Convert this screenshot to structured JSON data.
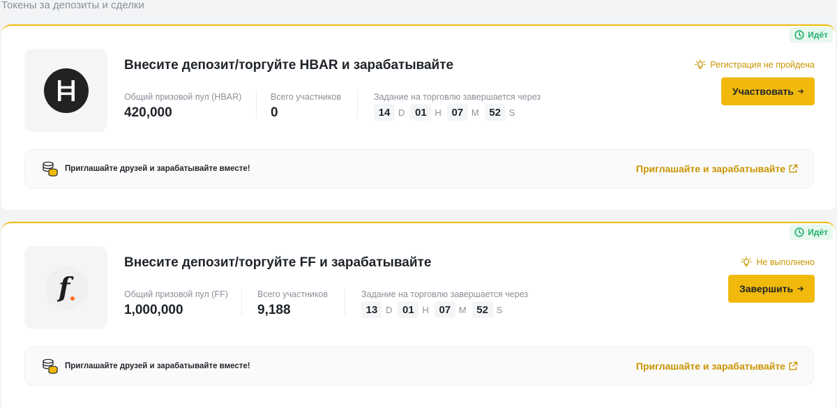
{
  "section_title": "Токены за депозиты и сделки",
  "colors": {
    "accent": "#f0b90b",
    "accent_text": "#c99400",
    "status_green": "#20b26c"
  },
  "cards": [
    {
      "status_badge": "Идёт",
      "title": "Внесите депозит/торгуйте HBAR и зарабатывайте",
      "logo_icon": "hbar-logo-icon",
      "pool_label": "Общий призовой пул (HBAR)",
      "pool_value": "420,000",
      "participants_label": "Всего участников",
      "participants_value": "0",
      "timer_label": "Задание на торговлю завершается через",
      "timer": {
        "d": "14",
        "d_unit": "D",
        "h": "01",
        "h_unit": "H",
        "m": "07",
        "m_unit": "M",
        "s": "52",
        "s_unit": "S"
      },
      "registration_status": "Регистрация не пройдена",
      "cta_label": "Участвовать",
      "invite_text": "Приглашайте друзей и зарабатывайте вместе!",
      "invite_link": "Приглашайте и зарабатывайте"
    },
    {
      "status_badge": "Идёт",
      "title": "Внесите депозит/торгуйте FF и зарабатывайте",
      "logo_icon": "ff-logo-icon",
      "pool_label": "Общий призовой пул (FF)",
      "pool_value": "1,000,000",
      "participants_label": "Всего участников",
      "participants_value": "9,188",
      "timer_label": "Задание на торговлю завершается через",
      "timer": {
        "d": "13",
        "d_unit": "D",
        "h": "01",
        "h_unit": "H",
        "m": "07",
        "m_unit": "M",
        "s": "52",
        "s_unit": "S"
      },
      "registration_status": "Не выполнено",
      "cta_label": "Завершить",
      "invite_text": "Приглашайте друзей и зарабатывайте вместе!",
      "invite_link": "Приглашайте и зарабатывайте"
    }
  ]
}
